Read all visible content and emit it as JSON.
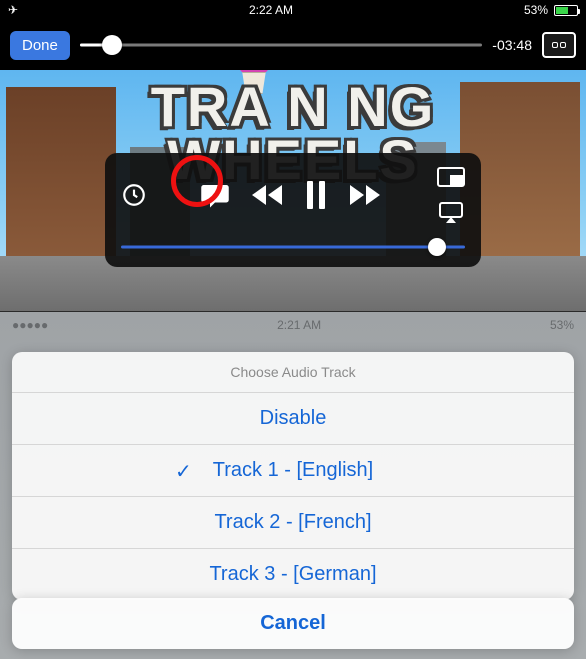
{
  "status": {
    "time": "2:22 AM",
    "battery_pct": "53%",
    "airplane": "✈︎"
  },
  "player": {
    "done_label": "Done",
    "time_remaining": "-03:48",
    "video_title": "TRA N NG\nWHEELS",
    "scrub_pct": 8,
    "volume_pct": 92
  },
  "icons": {
    "clock": "clock-icon",
    "subtitles": "subtitles-icon",
    "rewind": "rewind-icon",
    "pause": "pause-icon",
    "forward": "forward-icon",
    "pip": "picture-in-picture-icon",
    "airplay": "airplay-icon",
    "cc": "closed-caption-icon"
  },
  "sheet": {
    "dim_time": "2:21 AM",
    "dim_batt": "53%",
    "title": "Choose Audio Track",
    "options": [
      {
        "label": "Disable",
        "selected": false
      },
      {
        "label": "Track 1 - [English]",
        "selected": true
      },
      {
        "label": "Track 2 - [French]",
        "selected": false
      },
      {
        "label": "Track 3 - [German]",
        "selected": false
      }
    ],
    "cancel": "Cancel"
  }
}
